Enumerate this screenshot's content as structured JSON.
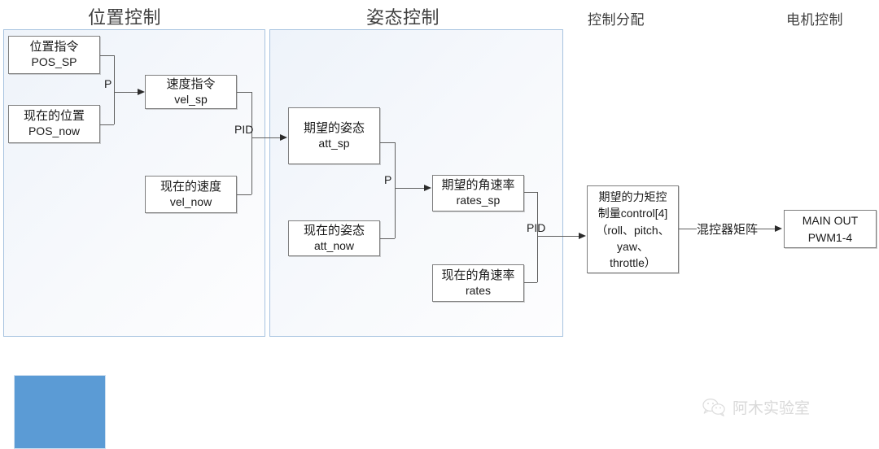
{
  "sections": [
    {
      "id": "position-control",
      "label": "位置控制"
    },
    {
      "id": "attitude-control",
      "label": "姿态控制"
    },
    {
      "id": "control-allocation",
      "label": "控制分配"
    },
    {
      "id": "motor-control",
      "label": "电机控制"
    }
  ],
  "nodes": {
    "pos_sp": {
      "cn": "位置指令",
      "en": "POS_SP"
    },
    "pos_now": {
      "cn": "现在的位置",
      "en": "POS_now"
    },
    "vel_sp": {
      "cn": "速度指令",
      "en": "vel_sp"
    },
    "vel_now": {
      "cn": "现在的速度",
      "en": "vel_now"
    },
    "att_sp": {
      "cn": "期望的姿态",
      "en": "att_sp"
    },
    "att_now": {
      "cn": "现在的姿态",
      "en": "att_now"
    },
    "rates_sp": {
      "cn": "期望的角速率",
      "en": "rates_sp"
    },
    "rates": {
      "cn": "现在的角速率",
      "en": "rates"
    },
    "control": {
      "lines": [
        "期望的力矩控",
        "制量control[4]",
        "（roll、pitch、",
        "yaw、",
        "throttle）"
      ]
    },
    "main_out": {
      "line1": "MAIN OUT",
      "line2": "PWM1-4"
    }
  },
  "edge_labels": {
    "pos_loop": "P",
    "vel_loop": "PID",
    "att_loop": "P",
    "rate_loop": "PID",
    "mixer": "混控器矩阵"
  },
  "watermark": {
    "text": "阿木实验室",
    "icon": "wechat-icon"
  },
  "colors": {
    "panel_border": "#a7c3e0",
    "panel_fill": "#eef3fa",
    "node_border": "#7f7f7f",
    "connector": "#5f5f5f",
    "blue_block": "#5b9bd5",
    "title_text": "#404040"
  }
}
